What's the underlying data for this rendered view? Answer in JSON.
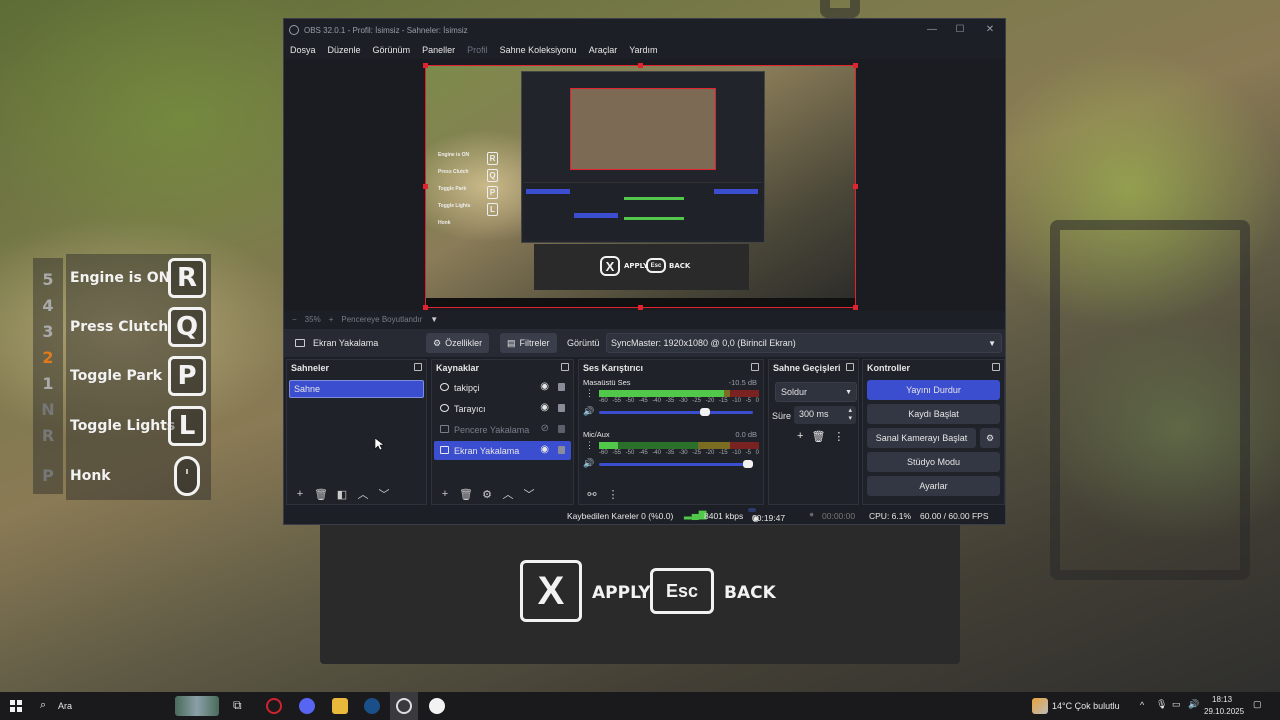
{
  "game": {
    "gears": [
      "5",
      "4",
      "3",
      "2",
      "1",
      "N",
      "R",
      "P"
    ],
    "active_gear": "2",
    "controls": [
      {
        "label": "Engine is ON",
        "key": "R"
      },
      {
        "label": "Press Clutch",
        "key": "Q"
      },
      {
        "label": "Toggle Park",
        "key": "P"
      },
      {
        "label": "Toggle Lights",
        "key": "L"
      },
      {
        "label": "Honk",
        "key": ""
      }
    ],
    "dialog": {
      "apply_key": "X",
      "apply_label": "APPLY",
      "back_key": "Esc",
      "back_label": "BACK"
    }
  },
  "obs": {
    "title": "OBS 32.0.1 - Profil: İsimsiz - Sahneler: İsimsiz",
    "menu": [
      "Dosya",
      "Düzenle",
      "Görünüm",
      "Paneller",
      "Profil",
      "Sahne Koleksiyonu",
      "Araçlar",
      "Yardım"
    ],
    "zoom": {
      "minus": "−",
      "percent": "35%",
      "plus": "+",
      "fit_label": "Pencereye Boyutlandır"
    },
    "toolbar": {
      "source_name": "Ekran Yakalama",
      "properties": "Özellikler",
      "filters": "Filtreler",
      "display_label": "Görüntü",
      "display_value": "SyncMaster: 1920x1080 @ 0,0 (Birincil Ekran)"
    },
    "scenes": {
      "title": "Sahneler",
      "items": [
        "Sahne"
      ]
    },
    "sources": {
      "title": "Kaynaklar",
      "items": [
        {
          "name": "takipçi",
          "hidden": false,
          "selected": false
        },
        {
          "name": "Tarayıcı",
          "hidden": false,
          "selected": false
        },
        {
          "name": "Pencere Yakalama",
          "hidden": true,
          "selected": false
        },
        {
          "name": "Ekran Yakalama",
          "hidden": false,
          "selected": true
        }
      ]
    },
    "mixer": {
      "title": "Ses Karıştırıcı",
      "ticks": [
        "-60",
        "-55",
        "-50",
        "-45",
        "-40",
        "-35",
        "-30",
        "-25",
        "-20",
        "-15",
        "-10",
        "-5",
        "0"
      ],
      "channels": [
        {
          "name": "Masaüstü Ses",
          "db": "-10.5 dB",
          "level": 0.78,
          "volume": 0.72
        },
        {
          "name": "Mic/Aux",
          "db": "0.0 dB",
          "level": 0.12,
          "volume": 1.0
        }
      ]
    },
    "transitions": {
      "title": "Sahne Geçişleri",
      "type": "Soldur",
      "duration_label": "Süre",
      "duration": "300 ms"
    },
    "controls": {
      "title": "Kontroller",
      "buttons": [
        "Yayını Durdur",
        "Kaydı Başlat",
        "Sanal Kamerayı Başlat",
        "Stüdyo Modu",
        "Ayarlar"
      ]
    },
    "status": {
      "dropped": "Kaybedilen Kareler 0 (%0.0)",
      "bitrate": "8401 kbps",
      "stream_time": "00:19:47",
      "rec_time": "00:00:00",
      "cpu": "CPU: 6.1%",
      "fps": "60.00 / 60.00 FPS"
    }
  },
  "taskbar": {
    "search": "Ara",
    "weather": "14°C  Çok bulutlu",
    "time": "18:13",
    "date": "29.10.2025"
  },
  "colors": {
    "accent": "#3b4ecf",
    "selection_red": "#e0232e",
    "active_gear": "#e07a1a"
  }
}
